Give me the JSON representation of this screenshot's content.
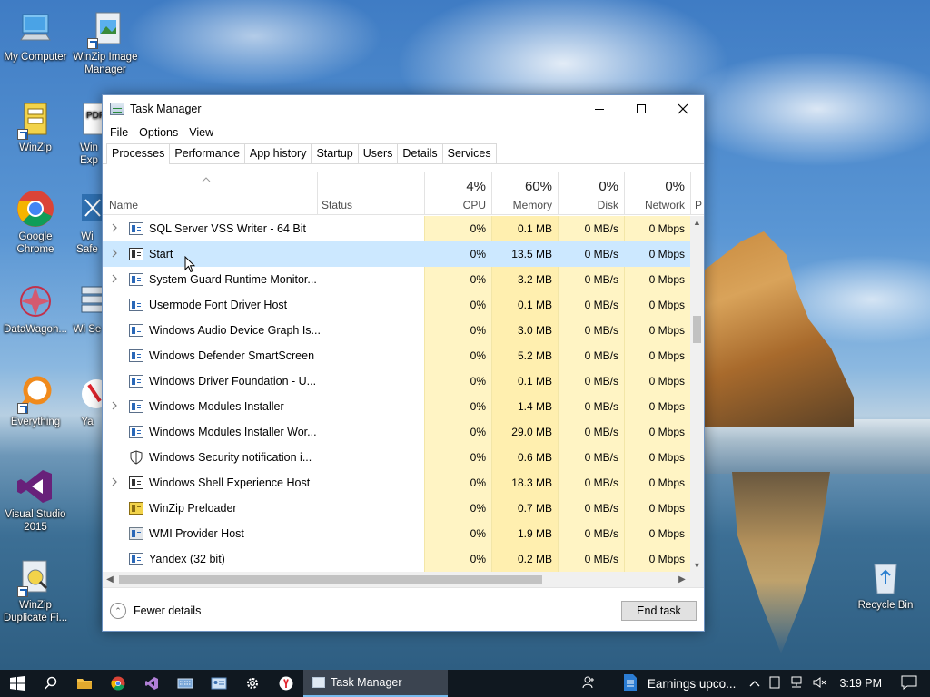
{
  "desktop": {
    "icons": [
      {
        "label": "My Computer"
      },
      {
        "label": "WinZip Image Manager"
      },
      {
        "label": "WinZip"
      },
      {
        "label": "Win Exp"
      },
      {
        "label": "Google Chrome"
      },
      {
        "label": "Wi Safe"
      },
      {
        "label": "DataWagon..."
      },
      {
        "label": "Wi Se"
      },
      {
        "label": "Everything"
      },
      {
        "label": "Ya"
      },
      {
        "label": "Visual Studio 2015"
      },
      {
        "label": "WinZip Duplicate Fi..."
      },
      {
        "label": "Recycle Bin"
      }
    ]
  },
  "window": {
    "title": "Task Manager",
    "menu": [
      "File",
      "Options",
      "View"
    ],
    "tabs": [
      "Processes",
      "Performance",
      "App history",
      "Startup",
      "Users",
      "Details",
      "Services"
    ],
    "active_tab": "Processes",
    "columns": {
      "name": "Name",
      "status": "Status",
      "cpu": {
        "pct": "4%",
        "label": "CPU"
      },
      "memory": {
        "pct": "60%",
        "label": "Memory"
      },
      "disk": {
        "pct": "0%",
        "label": "Disk"
      },
      "network": {
        "pct": "0%",
        "label": "Network"
      },
      "power_partial": "P"
    },
    "rows": [
      {
        "name": "SQL Server VSS Writer - 64 Bit",
        "expandable": true,
        "cpu": "0%",
        "mem": "0.1 MB",
        "disk": "0 MB/s",
        "net": "0 Mbps",
        "icon": "service-icon"
      },
      {
        "name": "Start",
        "expandable": true,
        "cpu": "0%",
        "mem": "13.5 MB",
        "disk": "0 MB/s",
        "net": "0 Mbps",
        "icon": "app-window-icon",
        "selected": true
      },
      {
        "name": "System Guard Runtime Monitor...",
        "expandable": true,
        "cpu": "0%",
        "mem": "3.2 MB",
        "disk": "0 MB/s",
        "net": "0 Mbps",
        "icon": "service-icon"
      },
      {
        "name": "Usermode Font Driver Host",
        "expandable": false,
        "cpu": "0%",
        "mem": "0.1 MB",
        "disk": "0 MB/s",
        "net": "0 Mbps",
        "icon": "service-icon"
      },
      {
        "name": "Windows Audio Device Graph Is...",
        "expandable": false,
        "cpu": "0%",
        "mem": "3.0 MB",
        "disk": "0 MB/s",
        "net": "0 Mbps",
        "icon": "service-icon"
      },
      {
        "name": "Windows Defender SmartScreen",
        "expandable": false,
        "cpu": "0%",
        "mem": "5.2 MB",
        "disk": "0 MB/s",
        "net": "0 Mbps",
        "icon": "service-icon"
      },
      {
        "name": "Windows Driver Foundation - U...",
        "expandable": false,
        "cpu": "0%",
        "mem": "0.1 MB",
        "disk": "0 MB/s",
        "net": "0 Mbps",
        "icon": "service-icon"
      },
      {
        "name": "Windows Modules Installer",
        "expandable": true,
        "cpu": "0%",
        "mem": "1.4 MB",
        "disk": "0 MB/s",
        "net": "0 Mbps",
        "icon": "service-icon"
      },
      {
        "name": "Windows Modules Installer Wor...",
        "expandable": false,
        "cpu": "0%",
        "mem": "29.0 MB",
        "disk": "0 MB/s",
        "net": "0 Mbps",
        "icon": "service-icon"
      },
      {
        "name": "Windows Security notification i...",
        "expandable": false,
        "cpu": "0%",
        "mem": "0.6 MB",
        "disk": "0 MB/s",
        "net": "0 Mbps",
        "icon": "shield-icon"
      },
      {
        "name": "Windows Shell Experience Host",
        "expandable": true,
        "cpu": "0%",
        "mem": "18.3 MB",
        "disk": "0 MB/s",
        "net": "0 Mbps",
        "icon": "app-window-icon"
      },
      {
        "name": "WinZip Preloader",
        "expandable": false,
        "cpu": "0%",
        "mem": "0.7 MB",
        "disk": "0 MB/s",
        "net": "0 Mbps",
        "icon": "winzip-icon"
      },
      {
        "name": "WMI Provider Host",
        "expandable": false,
        "cpu": "0%",
        "mem": "1.9 MB",
        "disk": "0 MB/s",
        "net": "0 Mbps",
        "icon": "wmi-icon"
      },
      {
        "name": "Yandex (32 bit)",
        "expandable": false,
        "cpu": "0%",
        "mem": "0.2 MB",
        "disk": "0 MB/s",
        "net": "0 Mbps",
        "icon": "service-icon"
      }
    ],
    "footer": {
      "fewer_details": "Fewer details",
      "end_task": "End task"
    }
  },
  "taskbar": {
    "active_app": "Task Manager",
    "notification_text": "Earnings upco...",
    "clock": "3:19 PM",
    "pinned": [
      "start-icon",
      "search-icon",
      "file-explorer-icon",
      "chrome-icon",
      "visual-studio-icon",
      "keyboard-icon",
      "id-card-icon",
      "settings-icon",
      "yandex-icon"
    ]
  },
  "colors": {
    "heat_light": "#fff4c4",
    "heat_memory": "#ffefaf",
    "selection": "#cce8ff",
    "taskbar": "#101820"
  }
}
